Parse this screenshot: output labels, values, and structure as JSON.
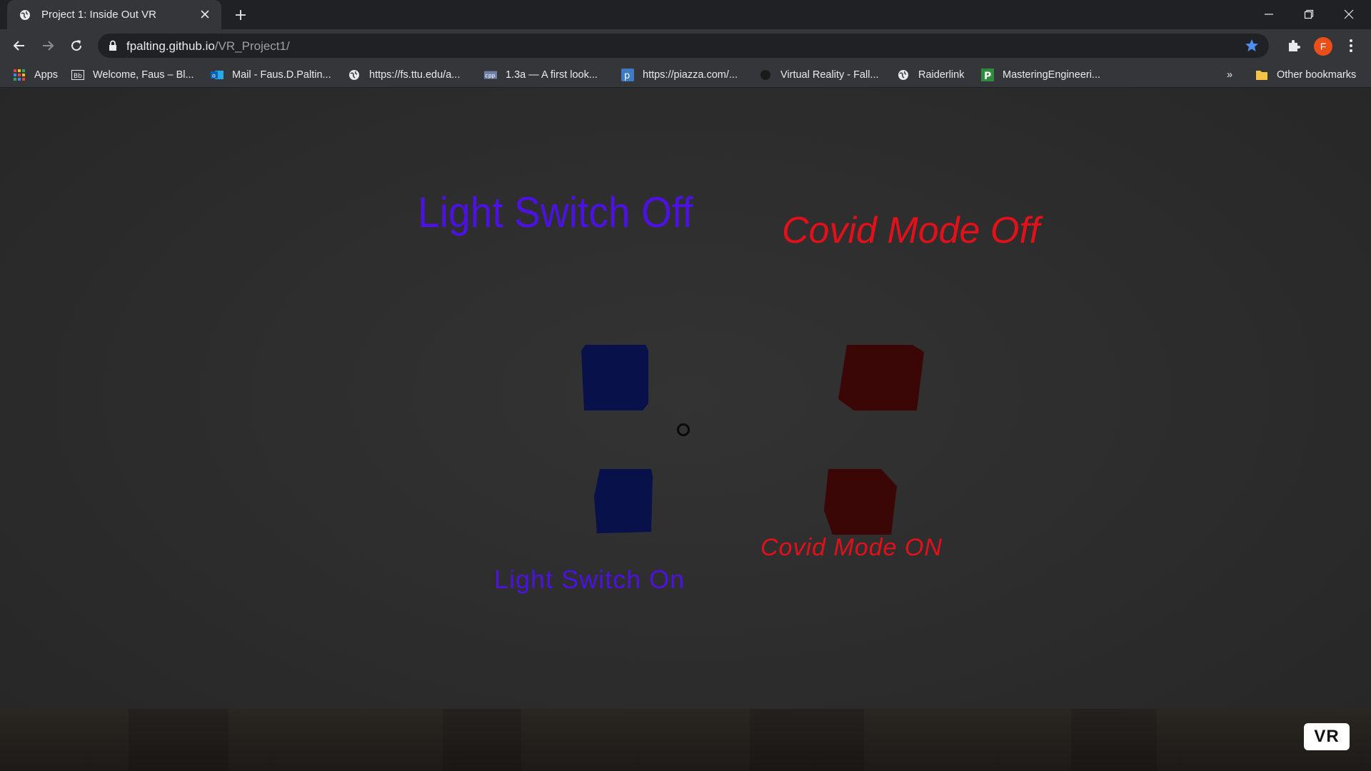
{
  "browser": {
    "tab": {
      "title": "Project 1: Inside Out VR",
      "favicon": "globe-icon"
    },
    "url_domain": "fpalting.github.io",
    "url_path": "/VR_Project1/",
    "profile_initial": "F",
    "bookmarks": [
      {
        "label": "Apps",
        "icon": "apps-grid-icon"
      },
      {
        "label": "Welcome, Faus – Bl...",
        "icon": "blackboard-icon"
      },
      {
        "label": "Mail - Faus.D.Paltin...",
        "icon": "outlook-icon"
      },
      {
        "label": "https://fs.ttu.edu/a...",
        "icon": "globe-icon"
      },
      {
        "label": "1.3a — A first look...",
        "icon": "cpp-icon"
      },
      {
        "label": "https://piazza.com/...",
        "icon": "piazza-icon"
      },
      {
        "label": "Virtual Reality - Fall...",
        "icon": "dark-logo-icon"
      },
      {
        "label": "Raiderlink",
        "icon": "globe-icon"
      },
      {
        "label": "MasteringEngineeri...",
        "icon": "mastering-p-icon"
      }
    ],
    "bookmarks_overflow": "»",
    "other_bookmarks": "Other bookmarks"
  },
  "scene": {
    "light_switch_off": "Light Switch Off",
    "covid_mode_off": "Covid Mode Off",
    "light_switch_on": "Light Switch On",
    "covid_mode_on": "Covid Mode ON",
    "vr_button": "VR",
    "colors": {
      "blue_text": "#4b12e0",
      "red_text": "#e2101a",
      "blue_cube": "#08114a",
      "red_cube": "#3a0606"
    }
  }
}
